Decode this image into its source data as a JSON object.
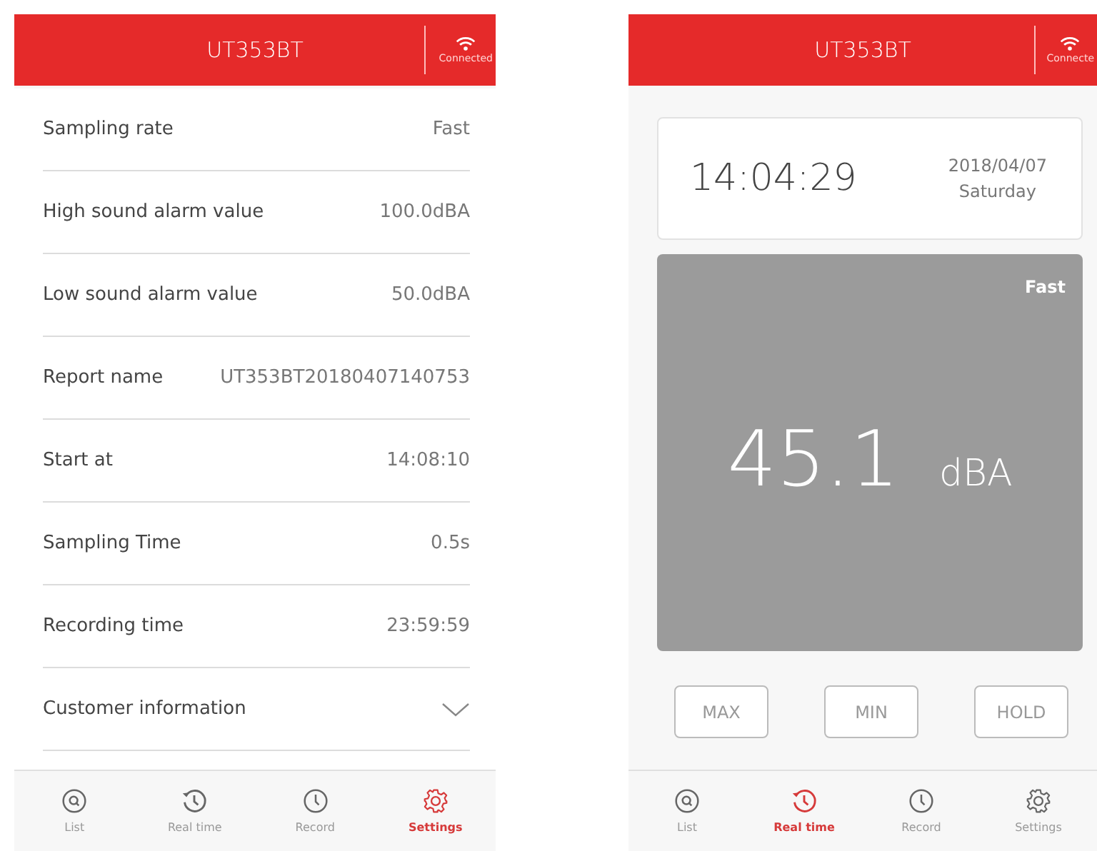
{
  "screens": [
    {
      "header": {
        "title": "UT353BT",
        "status": "Connected"
      },
      "settings": [
        {
          "kind": "value",
          "label": "Sampling rate",
          "value": "Fast"
        },
        {
          "kind": "value",
          "label": "High sound alarm value",
          "value": "100.0dBA"
        },
        {
          "kind": "value",
          "label": "Low sound alarm value",
          "value": "50.0dBA"
        },
        {
          "kind": "value",
          "label": "Report name",
          "value": "UT353BT20180407140753"
        },
        {
          "kind": "value",
          "label": "Start at",
          "value": "14:08:10"
        },
        {
          "kind": "value",
          "label": "Sampling Time",
          "value": "0.5s"
        },
        {
          "kind": "value",
          "label": "Recording time",
          "value": "23:59:59"
        },
        {
          "kind": "dropdown",
          "label": "Customer information"
        }
      ],
      "nav": [
        {
          "label": "List",
          "kind": "search",
          "selected": false
        },
        {
          "label": "Real time",
          "kind": "history",
          "selected": false
        },
        {
          "label": "Record",
          "kind": "clock",
          "selected": false
        },
        {
          "label": "Settings",
          "kind": "gear",
          "selected": true
        }
      ]
    },
    {
      "header": {
        "title": "UT353BT",
        "status": "Connecte"
      },
      "clock": {
        "time": "14:04:29",
        "date": "2018/04/07",
        "weekday": "Saturday"
      },
      "meter": {
        "mode": "Fast",
        "reading": "45.1",
        "unit": "dBA"
      },
      "buttons": [
        "MAX",
        "MIN",
        "HOLD"
      ],
      "nav": [
        {
          "label": "List",
          "kind": "search",
          "selected": false
        },
        {
          "label": "Real time",
          "kind": "history",
          "selected": true
        },
        {
          "label": "Record",
          "kind": "clock",
          "selected": false
        },
        {
          "label": "Settings",
          "kind": "gear",
          "selected": false
        }
      ]
    }
  ]
}
